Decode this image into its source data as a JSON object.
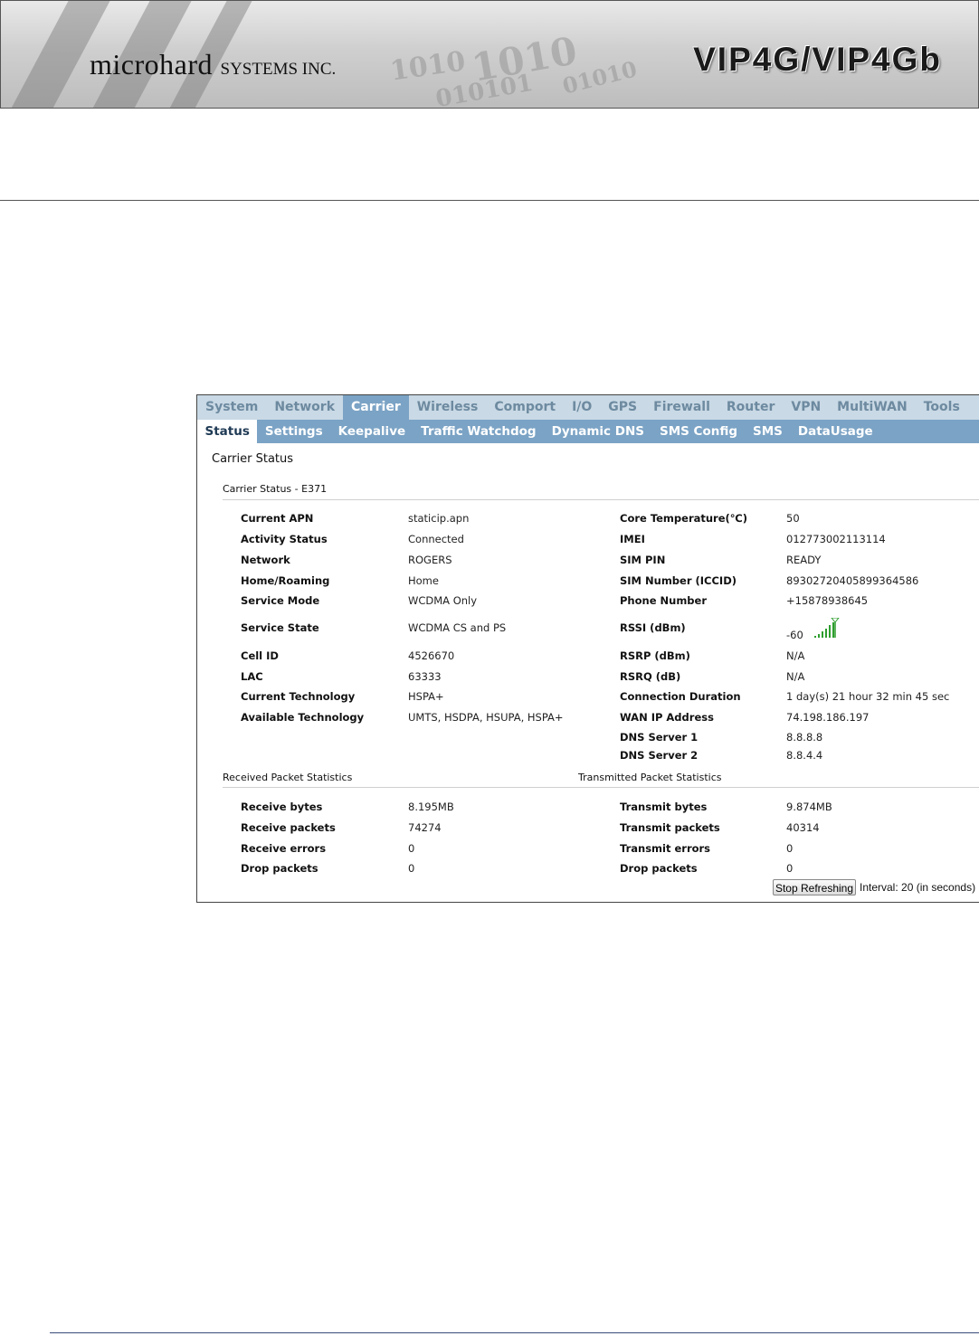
{
  "header": {
    "brand": "microhard",
    "brand_suffix": "SYSTEMS INC.",
    "product": "VIP4G/VIP4Gb"
  },
  "nav": {
    "main_tabs": [
      "System",
      "Network",
      "Carrier",
      "Wireless",
      "Comport",
      "I/O",
      "GPS",
      "Firewall",
      "Router",
      "VPN",
      "MultiWAN",
      "Tools"
    ],
    "active_main": "Carrier",
    "sub_tabs": [
      "Status",
      "Settings",
      "Keepalive",
      "Traffic Watchdog",
      "Dynamic DNS",
      "SMS Config",
      "SMS",
      "DataUsage"
    ],
    "active_sub": "Status"
  },
  "page": {
    "title": "Carrier Status",
    "section_carrier": "Carrier Status - E371",
    "section_rx": "Received Packet Statistics",
    "section_tx": "Transmitted Packet Statistics"
  },
  "carrier_left": [
    {
      "label": "Current APN",
      "value": "staticip.apn"
    },
    {
      "label": "Activity Status",
      "value": "Connected"
    },
    {
      "label": "Network",
      "value": "ROGERS"
    },
    {
      "label": "Home/Roaming",
      "value": "Home"
    },
    {
      "label": "Service Mode",
      "value": "WCDMA Only"
    },
    {
      "label": "Service State",
      "value": "WCDMA CS and PS"
    },
    {
      "label": "Cell ID",
      "value": "4526670"
    },
    {
      "label": "LAC",
      "value": "63333"
    },
    {
      "label": "Current Technology",
      "value": "HSPA+"
    },
    {
      "label": "Available Technology",
      "value": "UMTS, HSDPA, HSUPA, HSPA+"
    }
  ],
  "carrier_right": [
    {
      "label": "Core Temperature(℃)",
      "value": "50"
    },
    {
      "label": "IMEI",
      "value": "012773002113114"
    },
    {
      "label": "SIM PIN",
      "value": "READY"
    },
    {
      "label": "SIM Number (ICCID)",
      "value": "89302720405899364586"
    },
    {
      "label": "Phone Number",
      "value": "+15878938645"
    },
    {
      "label": "RSSI (dBm)",
      "value": "-60"
    },
    {
      "label": "RSRP (dBm)",
      "value": "N/A"
    },
    {
      "label": "RSRQ (dB)",
      "value": "N/A"
    },
    {
      "label": "Connection Duration",
      "value": "1 day(s) 21 hour 32 min 45 sec"
    },
    {
      "label": "WAN IP Address",
      "value": "74.198.186.197"
    },
    {
      "label": "DNS Server 1",
      "value": "8.8.8.8"
    },
    {
      "label": "DNS Server 2",
      "value": "8.8.4.4"
    }
  ],
  "rx_stats": [
    {
      "label": "Receive bytes",
      "value": "8.195MB"
    },
    {
      "label": "Receive packets",
      "value": "74274"
    },
    {
      "label": "Receive errors",
      "value": "0"
    },
    {
      "label": "Drop packets",
      "value": "0"
    }
  ],
  "tx_stats": [
    {
      "label": "Transmit bytes",
      "value": "9.874MB"
    },
    {
      "label": "Transmit packets",
      "value": "40314"
    },
    {
      "label": "Transmit errors",
      "value": "0"
    },
    {
      "label": "Drop packets",
      "value": "0"
    }
  ],
  "controls": {
    "stop_button": "Stop Refreshing",
    "interval_text": "Interval: 20 (in seconds)"
  },
  "colors": {
    "tab_bar": "#c9d9e5",
    "active_tab": "#7ba3c5",
    "signal": "#2e9e2e"
  },
  "icons": {
    "signal": "signal-strength-icon"
  }
}
